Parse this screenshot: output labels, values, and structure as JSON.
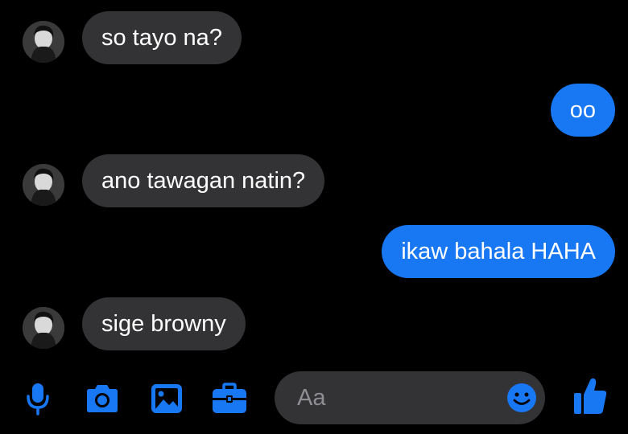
{
  "messages": [
    {
      "direction": "incoming",
      "text": "so tayo na?"
    },
    {
      "direction": "outgoing",
      "text": "oo"
    },
    {
      "direction": "incoming",
      "text": "ano tawagan natin?"
    },
    {
      "direction": "outgoing",
      "text": "ikaw bahala HAHA"
    },
    {
      "direction": "incoming",
      "text": "sige browny"
    }
  ],
  "composer": {
    "placeholder": "Aa",
    "icons": [
      "microphone-icon",
      "camera-icon",
      "gallery-icon",
      "briefcase-icon",
      "emoji-icon",
      "thumbs-up-icon"
    ]
  },
  "colors": {
    "background": "#000000",
    "incoming_bubble": "#333335",
    "outgoing_bubble": "#1877f2",
    "accent": "#1877f2",
    "text": "#ffffff",
    "placeholder": "#8e8e93"
  }
}
